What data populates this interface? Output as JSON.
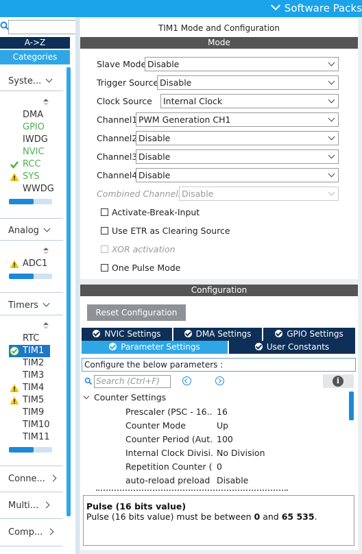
{
  "topbar": {
    "label": "Software Packs"
  },
  "sidebar": {
    "az_label": "A->Z",
    "categories_label": "Categories",
    "groups": {
      "system": {
        "label": "Syste...",
        "items": [
          {
            "label": "DMA",
            "status": "none"
          },
          {
            "label": "GPIO",
            "status": "green"
          },
          {
            "label": "IWDG",
            "status": "none"
          },
          {
            "label": "NVIC",
            "status": "green"
          },
          {
            "label": "RCC",
            "status": "check"
          },
          {
            "label": "SYS",
            "status": "warn"
          },
          {
            "label": "WWDG",
            "status": "none"
          }
        ]
      },
      "analog": {
        "label": "Analog",
        "items": [
          {
            "label": "ADC1",
            "status": "warn"
          }
        ]
      },
      "timers": {
        "label": "Timers",
        "items": [
          {
            "label": "RTC",
            "status": "none"
          },
          {
            "label": "TIM1",
            "status": "selected-check"
          },
          {
            "label": "TIM2",
            "status": "none"
          },
          {
            "label": "TIM3",
            "status": "none"
          },
          {
            "label": "TIM4",
            "status": "warn"
          },
          {
            "label": "TIM5",
            "status": "warn"
          },
          {
            "label": "TIM9",
            "status": "none"
          },
          {
            "label": "TIM10",
            "status": "none"
          },
          {
            "label": "TIM11",
            "status": "none"
          }
        ]
      },
      "connectivity": {
        "label": "Conne..."
      },
      "multimedia": {
        "label": "Multi..."
      },
      "computing": {
        "label": "Comp..."
      }
    }
  },
  "mode": {
    "title": "TIM1 Mode and Configuration",
    "section_label": "Mode",
    "fields": {
      "slave_mode": {
        "label": "Slave Mode",
        "value": "Disable"
      },
      "trigger_source": {
        "label": "Trigger Source",
        "value": "Disable"
      },
      "clock_source": {
        "label": "Clock Source",
        "value": "Internal Clock"
      },
      "channel1": {
        "label": "Channel1",
        "value": "PWM Generation CH1"
      },
      "channel2": {
        "label": "Channel2",
        "value": "Disable"
      },
      "channel3": {
        "label": "Channel3",
        "value": "Disable"
      },
      "channel4": {
        "label": "Channel4",
        "value": "Disable"
      },
      "combined_channels": {
        "label": "Combined Channels",
        "value": "Disable"
      }
    },
    "checkboxes": {
      "activate_break": {
        "label": "Activate-Break-Input",
        "checked": false
      },
      "use_etr": {
        "label": "Use ETR as Clearing Source",
        "checked": false
      },
      "xor_activation": {
        "label": "XOR activation",
        "checked": false
      },
      "one_pulse": {
        "label": "One Pulse Mode",
        "checked": false
      }
    }
  },
  "configuration": {
    "section_label": "Configuration",
    "reset_label": "Reset Configuration",
    "tabs": {
      "nvic": "NVIC Settings",
      "dma": "DMA Settings",
      "gpio": "GPIO Settings",
      "params": "Parameter Settings",
      "user_constants": "User Constants"
    },
    "caption": "Configure the below parameters :",
    "search_placeholder": "Search (Ctrl+F)",
    "tree": {
      "group_label": "Counter Settings",
      "params": [
        {
          "name": "Prescaler (PSC - 16...",
          "value": "16"
        },
        {
          "name": "Counter Mode",
          "value": "Up"
        },
        {
          "name": "Counter Period (Aut...",
          "value": "100"
        },
        {
          "name": "Internal Clock Divisi...",
          "value": "No Division"
        },
        {
          "name": "Repetition Counter (...",
          "value": "0"
        },
        {
          "name": "auto-reload preload",
          "value": "Disable"
        }
      ]
    },
    "description": {
      "title": "Pulse (16 bits value)",
      "text_prefix": "Pulse (16 bits value) must be between ",
      "min": "0",
      "and": " and ",
      "max": "65 535",
      "suffix": "."
    }
  }
}
